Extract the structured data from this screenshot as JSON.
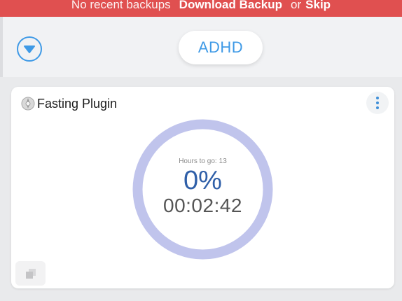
{
  "banner": {
    "message": "No recent backups",
    "download_label": "Download Backup",
    "or_text": "or",
    "skip_label": "Skip",
    "color": "#e05050"
  },
  "header": {
    "dropdown_icon": "chevron-down-circle-icon",
    "profile_label": "ADHD",
    "accent_color": "#3f9ae6"
  },
  "card": {
    "icon": "plugin-icon",
    "title": "Fasting Plugin",
    "more_icon": "more-vertical-icon",
    "progress": {
      "hours_to_go_label": "Hours to go:",
      "hours_to_go_value": "13",
      "percent_label": "0%",
      "percent_value": 0,
      "timer": "00:02:42",
      "ring_color": "#c0c4ec"
    },
    "corner_icon": "squares-icon"
  }
}
